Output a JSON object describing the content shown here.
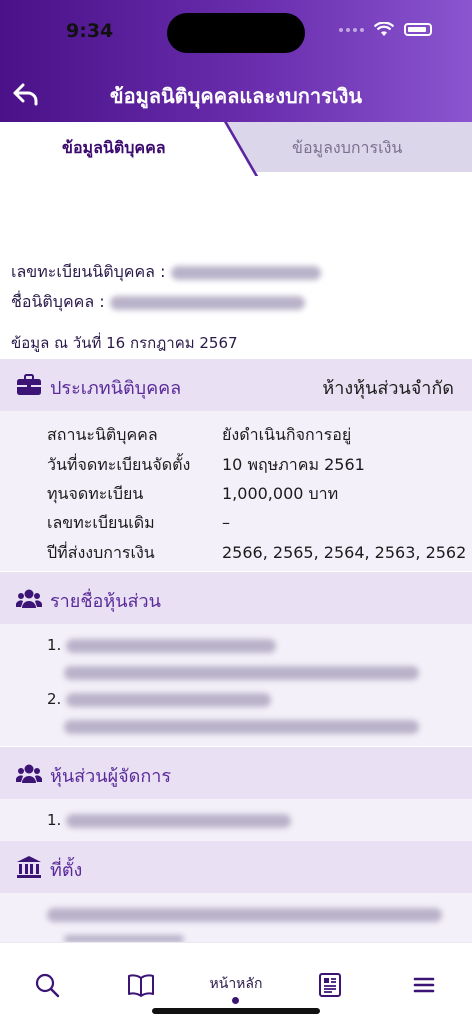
{
  "status_bar": {
    "time": "9:34"
  },
  "header": {
    "title": "ข้อมูลนิติบุคคลและงบการเงิน"
  },
  "tabs": [
    {
      "label": "ข้อมูลนิติบุคคล",
      "active": true
    },
    {
      "label": "ข้อมูลงบการเงิน",
      "active": false
    }
  ],
  "entity": {
    "registration_label": "เลขทะเบียนนิติบุคคล :",
    "name_label": "ชื่อนิติบุคคล :",
    "as_of": "ข้อมูล ณ วันที่ 16 กรกฎาคม 2567"
  },
  "entity_type": {
    "title": "ประเภทนิติบุคคล",
    "value": "ห้างหุ้นส่วนจำกัด",
    "rows": [
      {
        "label": "สถานะนิติบุคคล",
        "value": "ยังดำเนินกิจการอยู่"
      },
      {
        "label": "วันที่จดทะเบียนจัดตั้ง",
        "value": "10 พฤษภาคม 2561"
      },
      {
        "label": "ทุนจดทะเบียน",
        "value": "1,000,000 บาท"
      },
      {
        "label": "เลขทะเบียนเดิม",
        "value": "–"
      },
      {
        "label": "ปีที่ส่งงบการเงิน",
        "value": "2566, 2565, 2564, 2563, 2562"
      }
    ]
  },
  "partners": {
    "title": "รายชื่อหุ้นส่วน",
    "numbers": [
      "1.",
      "2."
    ]
  },
  "managing_partners": {
    "title": "หุ้นส่วนผู้จัดการ",
    "numbers": [
      "1."
    ]
  },
  "location": {
    "title": "ที่ตั้ง"
  },
  "tabbar": {
    "home_label": "หน้าหลัก"
  },
  "colors": {
    "accent": "#5a2a9a",
    "header_start": "#4a1188",
    "header_end": "#8a55cf",
    "section_bg": "#e9e1f3"
  }
}
